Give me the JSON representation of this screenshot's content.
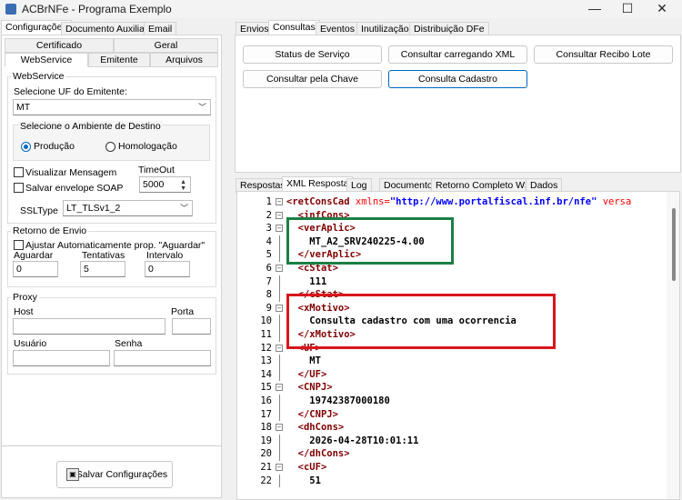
{
  "window": {
    "title": "ACBrNFe - Programa Exemplo",
    "min": "—",
    "max": "☐",
    "close": "✕"
  },
  "left": {
    "main_tabs": [
      "Configurações",
      "Documento Auxiliar",
      "Email"
    ],
    "sub_tabs_row1": [
      "Certificado",
      "Geral"
    ],
    "sub_tabs_row2": [
      "WebService",
      "Emitente",
      "Arquivos"
    ],
    "webservice": {
      "group": "WebService",
      "uf_label": "Selecione UF do Emitente:",
      "uf_value": "MT",
      "ambiente_group": "Selecione o Ambiente de Destino",
      "producao": "Produção",
      "homologacao": "Homologação",
      "visualizar": "Visualizar Mensagem",
      "salvar_soap": "Salvar envelope SOAP",
      "timeout_label": "TimeOut",
      "timeout_value": "5000",
      "ssltype_label": "SSLType",
      "ssltype_value": "LT_TLSv1_2"
    },
    "retorno": {
      "group": "Retorno de Envio",
      "ajustar": "Ajustar Automaticamente prop. \"Aguardar\"",
      "aguardar_label": "Aguardar",
      "aguardar": "0",
      "tentativas_label": "Tentativas",
      "tentativas": "5",
      "intervalo_label": "Intervalo",
      "intervalo": "0"
    },
    "proxy": {
      "group": "Proxy",
      "host": "Host",
      "porta": "Porta",
      "usuario": "Usuário",
      "senha": "Senha"
    },
    "save_button": "Salvar Configurações"
  },
  "right": {
    "main_tabs": [
      "Envios",
      "Consultas",
      "Eventos",
      "Inutilização",
      "Distribuição DFe"
    ],
    "buttons": [
      "Status de Serviço",
      "Consultar carregando XML",
      "Consultar Recibo Lote",
      "Consultar pela Chave",
      "Consulta Cadastro"
    ],
    "result_tabs": [
      "Respostas",
      "XML Resposta",
      "Log",
      "Documento",
      "Retorno Completo WS",
      "Dados"
    ],
    "xml_lines": [
      {
        "n": "1",
        "indent": "",
        "open": "<retConsCad",
        "attr": " xmlns=",
        "val": "\"http://www.portalfiscal.inf.br/nfe\"",
        "tail": " versa"
      },
      {
        "n": "2",
        "indent": "  ",
        "open": "<infCons>"
      },
      {
        "n": "3",
        "indent": "  ",
        "open": "<verAplic>"
      },
      {
        "n": "4",
        "indent": "    ",
        "text": "MT_A2_SRV240225-4.00"
      },
      {
        "n": "5",
        "indent": "  ",
        "open": "</verAplic>"
      },
      {
        "n": "6",
        "indent": "  ",
        "open": "<cStat>"
      },
      {
        "n": "7",
        "indent": "    ",
        "text": "111"
      },
      {
        "n": "8",
        "indent": "  ",
        "open": "</cStat>"
      },
      {
        "n": "9",
        "indent": "  ",
        "open": "<xMotivo>"
      },
      {
        "n": "10",
        "indent": "    ",
        "text": "Consulta cadastro com uma ocorrencia"
      },
      {
        "n": "11",
        "indent": "  ",
        "open": "</xMotivo>"
      },
      {
        "n": "12",
        "indent": "  ",
        "open": "<UF>"
      },
      {
        "n": "13",
        "indent": "    ",
        "text": "MT"
      },
      {
        "n": "14",
        "indent": "  ",
        "open": "</UF>"
      },
      {
        "n": "15",
        "indent": "  ",
        "open": "<CNPJ>"
      },
      {
        "n": "16",
        "indent": "    ",
        "text": "19742387000180"
      },
      {
        "n": "17",
        "indent": "  ",
        "open": "</CNPJ>"
      },
      {
        "n": "18",
        "indent": "  ",
        "open": "<dhCons>"
      },
      {
        "n": "19",
        "indent": "    ",
        "text": "2026-04-28T10:01:11"
      },
      {
        "n": "20",
        "indent": "  ",
        "open": "</dhCons>"
      },
      {
        "n": "21",
        "indent": "  ",
        "open": "<cUF>"
      },
      {
        "n": "22",
        "indent": "    ",
        "text": "51"
      }
    ],
    "highlights": {
      "green": "#1a7f45",
      "red": "#d9161d"
    }
  }
}
